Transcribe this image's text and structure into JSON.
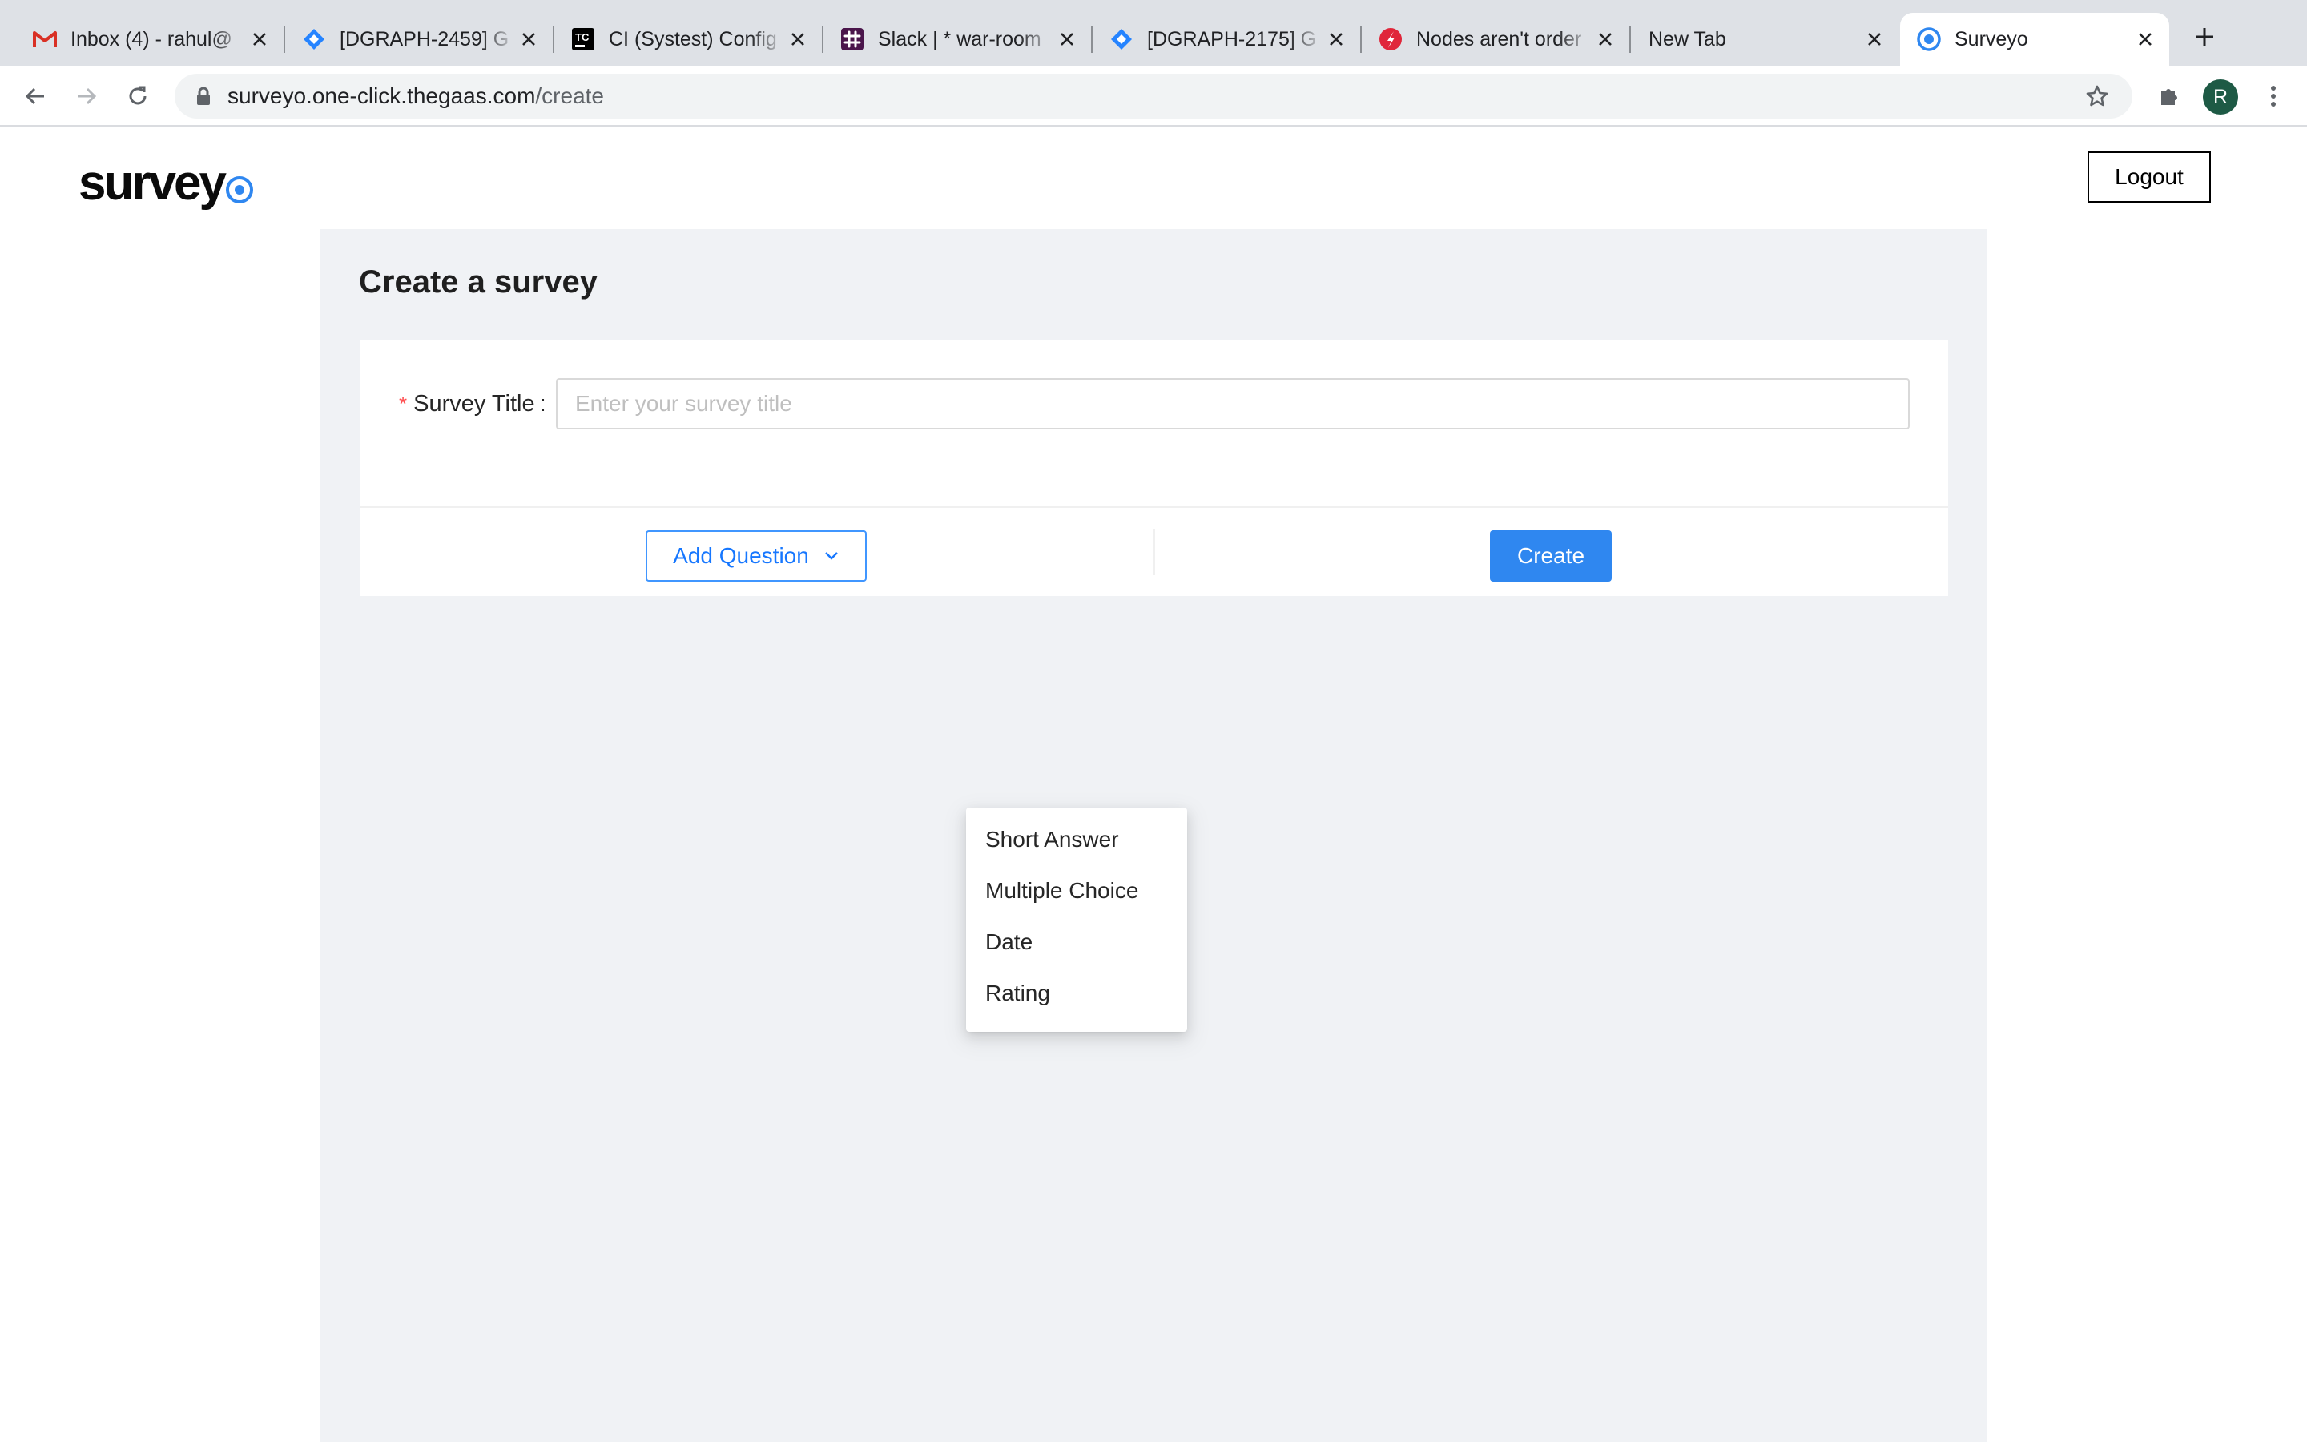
{
  "browser": {
    "tabs": [
      {
        "title": "Inbox (4) - rahul@",
        "icon": "gmail-icon",
        "active": false
      },
      {
        "title": "[DGRAPH-2459] G",
        "icon": "jira-icon",
        "active": false
      },
      {
        "title": "CI (Systest) Config",
        "icon": "teamcity-icon",
        "active": false
      },
      {
        "title": "Slack | * war-room",
        "icon": "slack-icon",
        "active": false
      },
      {
        "title": "[DGRAPH-2175] G",
        "icon": "jira-icon",
        "active": false
      },
      {
        "title": "Nodes aren't order",
        "icon": "discuss-icon",
        "active": false
      },
      {
        "title": "New Tab",
        "icon": "",
        "active": false
      },
      {
        "title": "Surveyo",
        "icon": "surveyo-icon",
        "active": true
      }
    ],
    "url": {
      "host": "surveyo.one-click.thegaas.com",
      "path": "/create"
    },
    "profile_initial": "R"
  },
  "header": {
    "logo_text": "survey",
    "logout_label": "Logout"
  },
  "form": {
    "page_title": "Create a survey",
    "required_mark": "*",
    "title_label": "Survey Title",
    "title_colon": ":",
    "title_value": "",
    "title_placeholder": "Enter your survey title",
    "add_question_label": "Add Question",
    "create_label": "Create"
  },
  "dropdown": {
    "items": [
      "Short Answer",
      "Multiple Choice",
      "Date",
      "Rating"
    ]
  },
  "colors": {
    "accent": "#2f87f0",
    "link_blue": "#1677ff",
    "required": "#ff4d4f",
    "panel_bg": "#f0f2f5"
  }
}
